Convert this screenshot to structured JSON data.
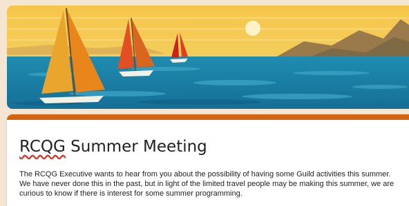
{
  "form": {
    "title_first": "RCQG",
    "title_rest": " Summer Meeting",
    "description": "The RCQG Executive wants to hear from you about the possibility of having some Guild activities this summer. We have never done this in the past, but in light of the limited travel people may be making this summer, we are curious to know if there is interest for some summer programming."
  },
  "theme": {
    "accent": "#d4640e",
    "page_background": "#f4e6d3",
    "header_image": "sailboats-sunset-illustration"
  }
}
